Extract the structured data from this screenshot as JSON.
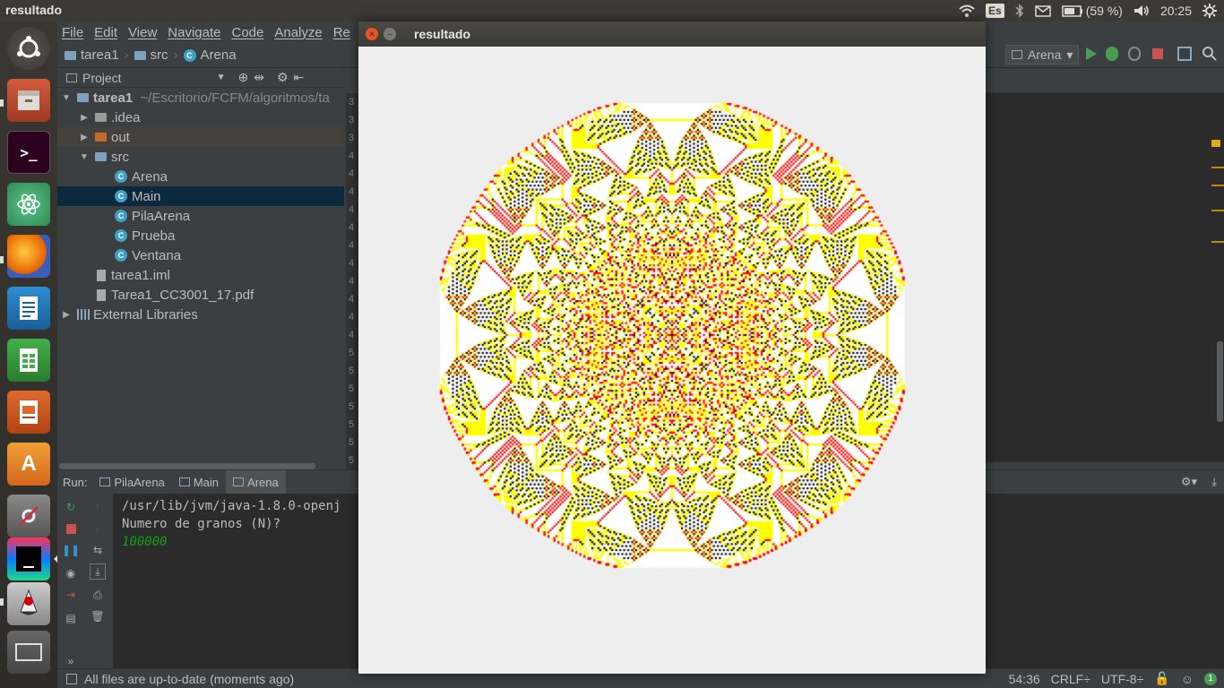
{
  "topbar": {
    "window_title": "resultado",
    "keyboard_lang": "Es",
    "battery": "(59 %)",
    "clock": "20:25"
  },
  "launcher": {
    "icons": [
      "ubuntu-dash-icon",
      "file-manager-icon",
      "terminal-icon",
      "atom-icon",
      "firefox-icon",
      "writer-icon",
      "calc-icon",
      "impress-icon",
      "software-center-icon",
      "settings-icon",
      "intellij-icon",
      "java-icon",
      "workspace-icon"
    ]
  },
  "menu": [
    "File",
    "Edit",
    "View",
    "Navigate",
    "Code",
    "Analyze",
    "Re"
  ],
  "breadcrumb": [
    "tarea1",
    "src",
    "Arena"
  ],
  "run_config": "Arena",
  "project_panel": {
    "title": "Project",
    "tree": [
      {
        "label": "tarea1",
        "extra": "~/Escritorio/FCFM/algoritmos/ta"
      },
      {
        "label": ".idea"
      },
      {
        "label": "out"
      },
      {
        "label": "src"
      },
      {
        "label": "Arena"
      },
      {
        "label": "Main"
      },
      {
        "label": "PilaArena"
      },
      {
        "label": "Prueba"
      },
      {
        "label": "Ventana"
      },
      {
        "label": "tarea1.iml"
      },
      {
        "label": "Tarea1_CC3001_17.pdf"
      },
      {
        "label": "External Libraries"
      }
    ]
  },
  "gutter_lines": [
    "3",
    "3",
    "3",
    "4",
    "4",
    "4",
    "4",
    "4",
    "4",
    "4",
    "4",
    "4",
    "4",
    "4",
    "5",
    "5",
    "5",
    "5",
    "5",
    "5",
    "5"
  ],
  "run_panel": {
    "label": "Run:",
    "tabs": [
      "PilaArena",
      "Main",
      "Arena"
    ],
    "console": {
      "line1": "/usr/lib/jvm/java-1.8.0-openj",
      "line2": "Numero de granos (N)?",
      "input": "100000"
    }
  },
  "status": {
    "message": "All files are up-to-date (moments ago)",
    "position": "54:36",
    "line_sep": "CRLF÷",
    "encoding": "UTF-8÷"
  },
  "result_window": {
    "title": "resultado"
  },
  "sandpile": {
    "colors": {
      "empty": "#000000",
      "one": "#ff0000",
      "two": "#ffff00",
      "three": "#ffffff",
      "bg": "#eeeeee"
    },
    "grains": 100000
  }
}
